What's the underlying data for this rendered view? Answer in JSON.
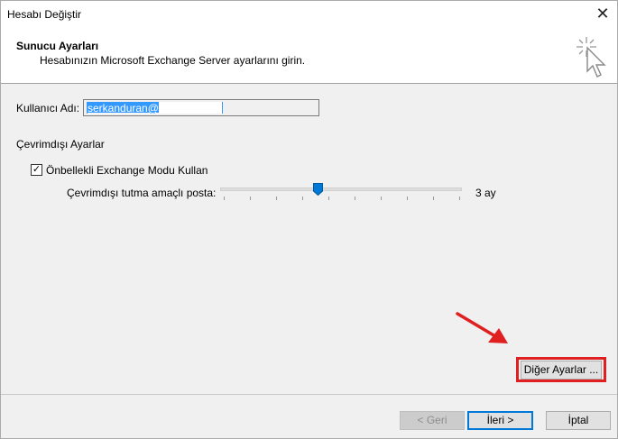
{
  "window": {
    "title": "Hesabı Değiştir",
    "close_glyph": "✕"
  },
  "header": {
    "title": "Sunucu Ayarları",
    "subtitle": "Hesabınızın Microsoft Exchange Server ayarlarını girin.",
    "icon": "wizard-cursor-icon"
  },
  "user": {
    "label": "Kullanıcı Adı:",
    "value": "serkanduran@"
  },
  "offline": {
    "section_label": "Çevrimdışı Ayarlar",
    "cached_mode_label": "Önbellekli Exchange Modu Kullan",
    "cached_mode_checked": true,
    "check_glyph": "✓",
    "retention_label": "Çevrimdışı tutma amaçlı posta:",
    "retention_value": "3 ay"
  },
  "buttons": {
    "other_settings": "Diğer Ayarlar ...",
    "back": "< Geri",
    "next": "İleri >",
    "cancel": "İptal"
  },
  "colors": {
    "accent": "#0078d7",
    "highlight": "#e02020",
    "selection": "#3399ff"
  }
}
